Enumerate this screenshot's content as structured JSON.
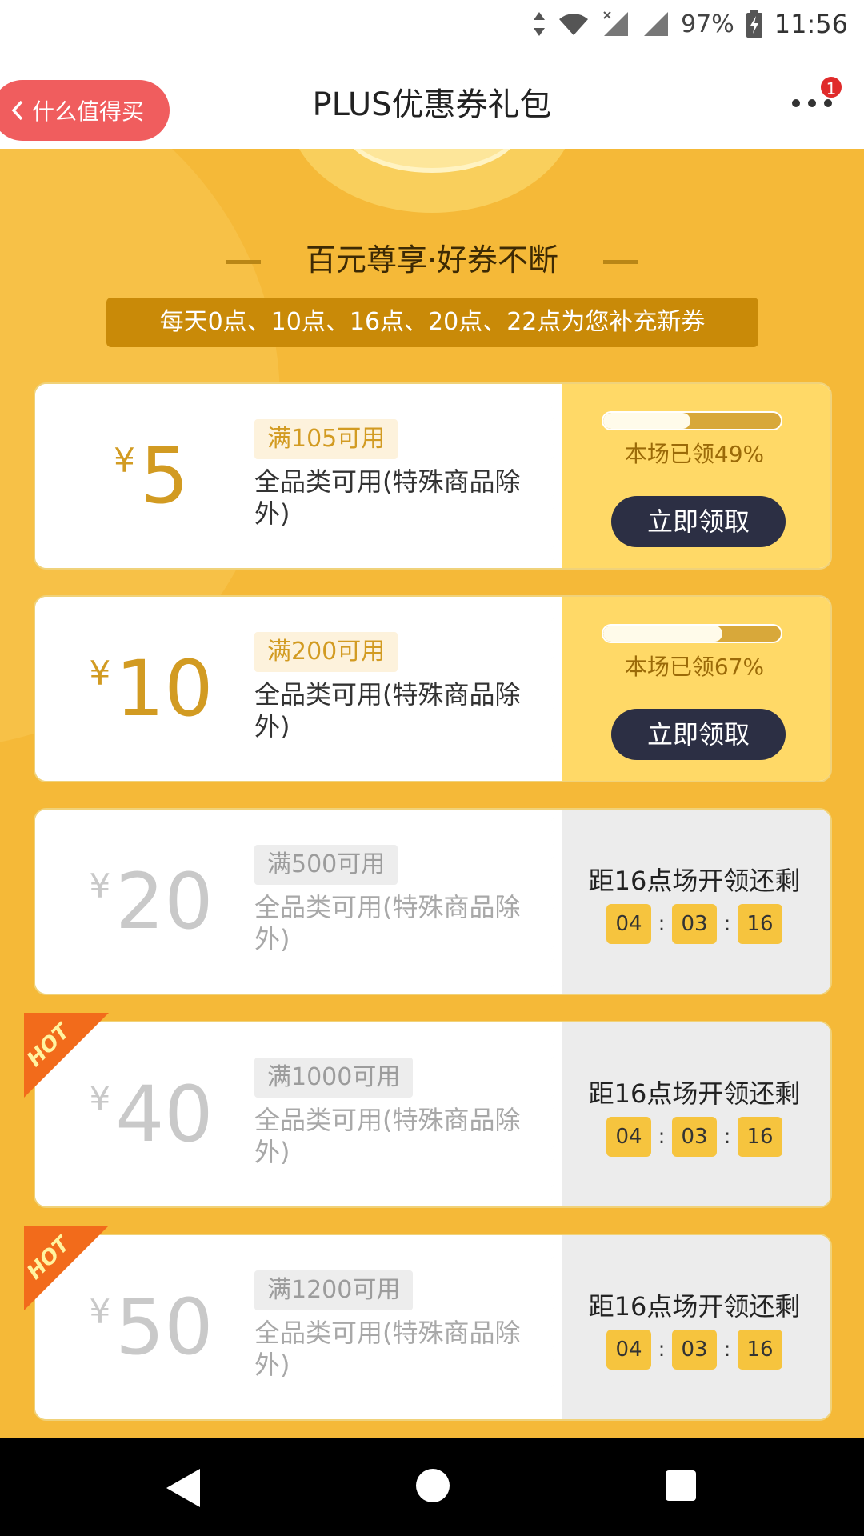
{
  "status_bar": {
    "battery": "97%",
    "time": "11:56"
  },
  "nav": {
    "back_label": "什么值得买",
    "title": "PLUS优惠券礼包",
    "badge_count": "1"
  },
  "banner": {
    "headline": "百元尊享·好券不断",
    "notice": "每天0点、10点、16点、20点、22点为您补充新券"
  },
  "coupons": [
    {
      "currency": "¥",
      "amount": "5",
      "condition": "满105可用",
      "description": "全品类可用(特殊商品除外)",
      "state": "available",
      "claimed_text": "本场已领49%",
      "claimed_fraction": 0.49,
      "button_label": "立即领取",
      "hot": false
    },
    {
      "currency": "¥",
      "amount": "10",
      "condition": "满200可用",
      "description": "全品类可用(特殊商品除外)",
      "state": "available",
      "claimed_text": "本场已领67%",
      "claimed_fraction": 0.67,
      "button_label": "立即领取",
      "hot": false
    },
    {
      "currency": "¥",
      "amount": "20",
      "condition": "满500可用",
      "description": "全品类可用(特殊商品除外)",
      "state": "pending",
      "countdown_label": "距16点场开领还剩",
      "timer": [
        "04",
        "03",
        "16"
      ],
      "hot": false
    },
    {
      "currency": "¥",
      "amount": "40",
      "condition": "满1000可用",
      "description": "全品类可用(特殊商品除外)",
      "state": "pending",
      "countdown_label": "距16点场开领还剩",
      "timer": [
        "04",
        "03",
        "16"
      ],
      "hot": true,
      "hot_label": "HOT"
    },
    {
      "currency": "¥",
      "amount": "50",
      "condition": "满1200可用",
      "description": "全品类可用(特殊商品除外)",
      "state": "pending",
      "countdown_label": "距16点场开领还剩",
      "timer": [
        "04",
        "03",
        "16"
      ],
      "hot": true,
      "hot_label": "HOT"
    }
  ],
  "colors": {
    "page_bg": "#f5b938",
    "accent_gold": "#d29b22",
    "claim_button": "#2c2f44",
    "back_pill": "#f05d5e",
    "notice_bg": "#c98a08"
  }
}
